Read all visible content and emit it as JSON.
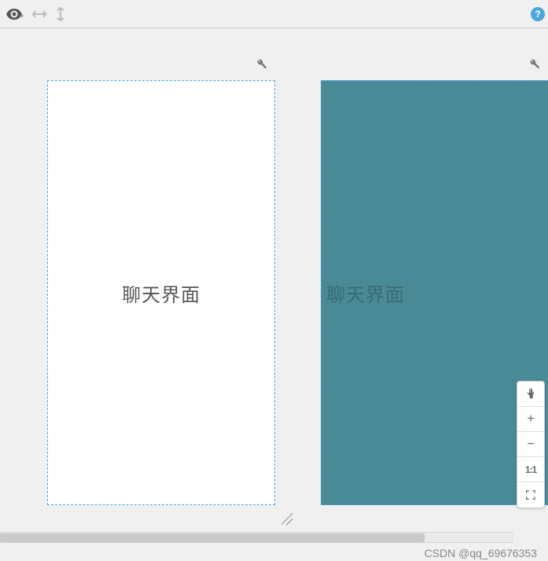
{
  "toolbar": {
    "help_label": "?"
  },
  "frames": [
    {
      "label": "聊天界面",
      "bg": "#ffffff",
      "text_color": "#555555"
    },
    {
      "label": "聊天界面",
      "bg": "#4a8a96",
      "text_color": "#305f68"
    }
  ],
  "zoom": {
    "pan": "✋",
    "zoom_in": "+",
    "zoom_out": "−",
    "ratio": "1:1",
    "fit": "⛶"
  },
  "watermark": "CSDN @qq_69676353"
}
